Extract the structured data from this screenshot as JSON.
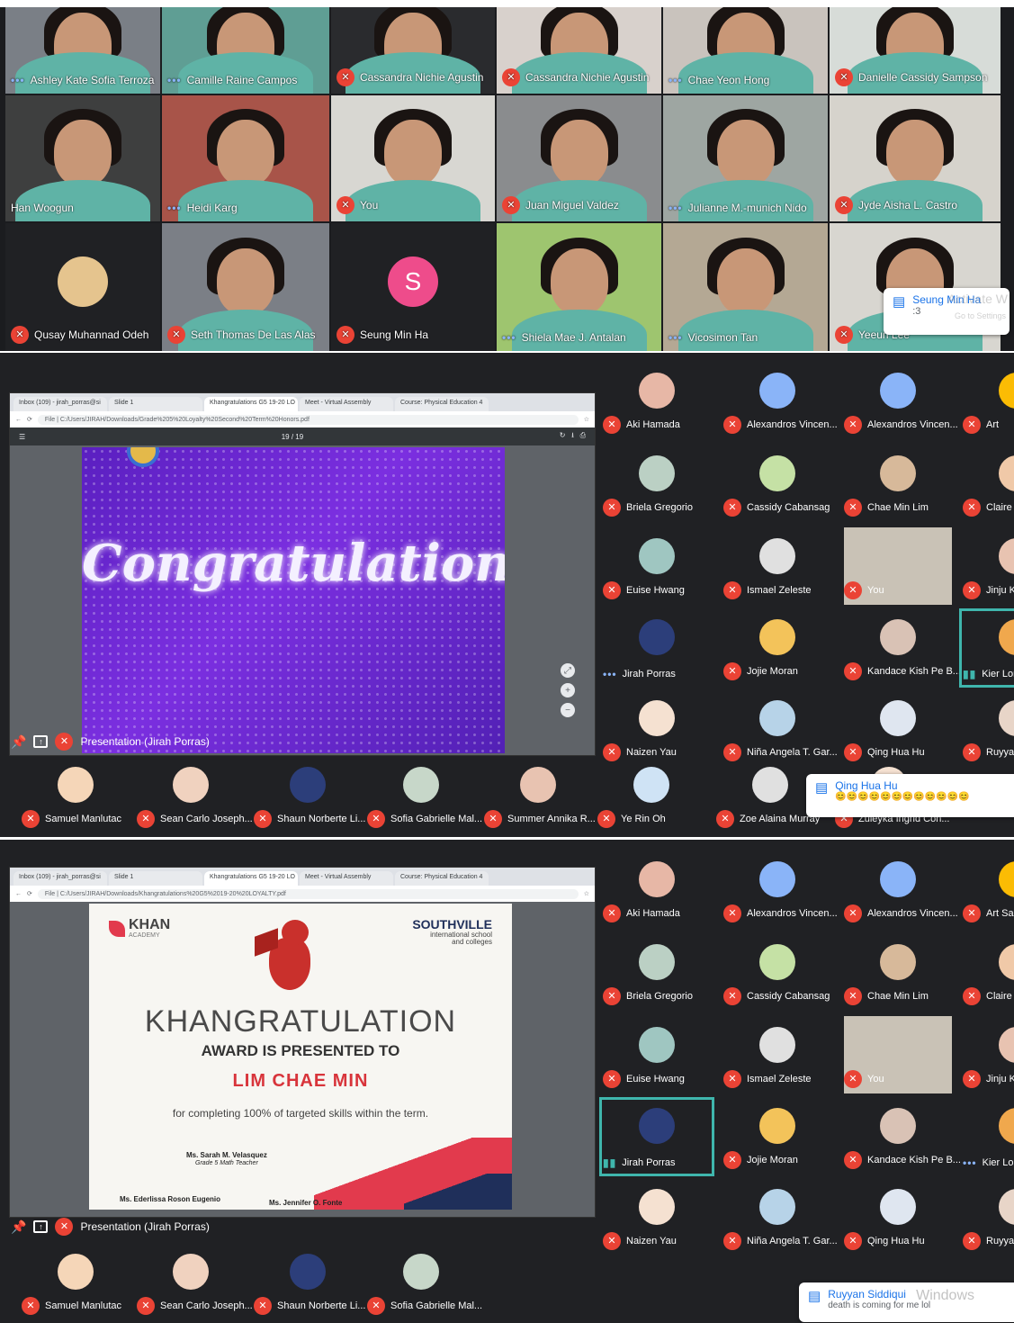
{
  "screen1": {
    "tiles": [
      {
        "name": "Ashley Kate Sofia Terroza",
        "status": "dots"
      },
      {
        "name": "Camille Raine Campos",
        "status": "dots"
      },
      {
        "name": "Cassandra Nichie Agustin",
        "status": "muted"
      },
      {
        "name": "Cassandra Nichie Agustin",
        "status": "muted"
      },
      {
        "name": "Chae Yeon Hong",
        "status": "dots"
      },
      {
        "name": "Danielle Cassidy Sampson",
        "status": "muted"
      },
      {
        "name": "Han Woogun",
        "status": "none"
      },
      {
        "name": "Heidi Karg",
        "status": "dots"
      },
      {
        "name": "You",
        "status": "muted"
      },
      {
        "name": "Juan Miguel Valdez",
        "status": "muted"
      },
      {
        "name": "Julianne M.-munich Nido",
        "status": "dots"
      },
      {
        "name": "Jyde Aisha L. Castro",
        "status": "muted"
      },
      {
        "name": "Qusay Muhannad Odeh",
        "status": "muted"
      },
      {
        "name": "Seth Thomas De Las Alas",
        "status": "muted"
      },
      {
        "name": "Seung Min Ha",
        "status": "muted"
      },
      {
        "name": "Shiela Mae J. Antalan",
        "status": "dots"
      },
      {
        "name": "Vicosimon Tan",
        "status": "dots"
      },
      {
        "name": "Yeeun Lee",
        "status": "muted"
      }
    ],
    "avatar_letter": "S",
    "chat": {
      "sender": "Seung Min Ha",
      "message": ":3"
    },
    "watermark": "Activate W",
    "watermark_sub": "Go to Settings"
  },
  "screen2": {
    "browser_tabs": [
      "Inbox (109) - jirah_porras@si",
      "Slide 1",
      "Khangratulations G5 19-20 LO",
      "Meet - Virtual Assembly",
      "Course: Physical Education 4"
    ],
    "url": "File | C:/Users/JIRAH/Downloads/Grade%205%20Loyalty%20Second%20Term%20Honors.pdf",
    "page_count": "19 / 19",
    "slide_text": "Congratulations!",
    "presentation_label": "Presentation (Jirah Porras)",
    "participants": [
      {
        "name": "Aki Hamada",
        "status": "muted"
      },
      {
        "name": "Alexandros Vincen...",
        "status": "muted"
      },
      {
        "name": "Alexandros Vincen...",
        "status": "muted"
      },
      {
        "name": "Art",
        "status": "muted"
      },
      {
        "name": "Briela Gregorio",
        "status": "muted"
      },
      {
        "name": "Cassidy Cabansag",
        "status": "muted"
      },
      {
        "name": "Chae Min Lim",
        "status": "muted"
      },
      {
        "name": "Claire",
        "status": "muted"
      },
      {
        "name": "Euise Hwang",
        "status": "muted"
      },
      {
        "name": "Ismael Zeleste",
        "status": "muted"
      },
      {
        "name": "You",
        "status": "muted"
      },
      {
        "name": "Jinju K",
        "status": "muted"
      },
      {
        "name": "Jirah Porras",
        "status": "dots"
      },
      {
        "name": "Jojie Moran",
        "status": "muted"
      },
      {
        "name": "Kandace Kish Pe B...",
        "status": "muted"
      },
      {
        "name": "Kier Lor",
        "status": "speaking"
      },
      {
        "name": "Naizen Yau",
        "status": "muted"
      },
      {
        "name": "Niña Angela T. Gar...",
        "status": "muted"
      },
      {
        "name": "Qing Hua Hu",
        "status": "muted"
      },
      {
        "name": "Ruyyan S",
        "status": "muted"
      }
    ],
    "strip": [
      {
        "name": "Samuel Manlutac"
      },
      {
        "name": "Sean Carlo Joseph..."
      },
      {
        "name": "Shaun Norberte Li..."
      },
      {
        "name": "Sofia Gabrielle Mal..."
      },
      {
        "name": "Summer Annika R..."
      },
      {
        "name": "Ye Rin Oh"
      },
      {
        "name": "Zoe Alaina Murray"
      },
      {
        "name": "Zuleyka Ingrid Con..."
      }
    ],
    "chat": {
      "sender": "Qing Hua Hu",
      "message": "😊😊😊😊😊😊😊😊😊😊😊😊"
    }
  },
  "screen3": {
    "browser_tabs": [
      "Inbox (109) - jirah_porras@si",
      "Slide 1",
      "Khangratulations G5 19-20 LO",
      "Meet - Virtual Assembly",
      "Course: Physical Education 4"
    ],
    "url": "File | C:/Users/JIRAH/Downloads/Khangratulations%20G5%2019-20%20LOYALTY.pdf",
    "cert": {
      "khan": "KHAN",
      "academy": "ACADEMY",
      "school": "SOUTHVILLE",
      "school_sub1": "international school",
      "school_sub2": "and colleges",
      "title": "KHANGRATULATION",
      "subtitle": "AWARD IS PRESENTED TO",
      "awardee": "LIM CHAE MIN",
      "body": "for completing 100% of targeted skills within the term.",
      "signer1": "Ms. Sarah M. Velasquez",
      "signer1_role": "Grade 5 Math Teacher",
      "signer2": "Ms. Ederlissa Roson Eugenio",
      "signer3": "Ms. Jennifer O. Fonte"
    },
    "presentation_label": "Presentation (Jirah Porras)",
    "participants": [
      {
        "name": "Aki Hamada",
        "status": "muted"
      },
      {
        "name": "Alexandros Vincen...",
        "status": "muted"
      },
      {
        "name": "Alexandros Vincen...",
        "status": "muted"
      },
      {
        "name": "Art Sa",
        "status": "muted"
      },
      {
        "name": "Briela Gregorio",
        "status": "muted"
      },
      {
        "name": "Cassidy Cabansag",
        "status": "muted"
      },
      {
        "name": "Chae Min Lim",
        "status": "muted"
      },
      {
        "name": "Claire C",
        "status": "muted"
      },
      {
        "name": "Euise Hwang",
        "status": "muted"
      },
      {
        "name": "Ismael Zeleste",
        "status": "muted"
      },
      {
        "name": "You",
        "status": "muted"
      },
      {
        "name": "Jinju Ki",
        "status": "muted"
      },
      {
        "name": "Jirah Porras",
        "status": "speaking"
      },
      {
        "name": "Jojie Moran",
        "status": "muted"
      },
      {
        "name": "Kandace Kish Pe B...",
        "status": "muted"
      },
      {
        "name": "Kier Lore",
        "status": "dots"
      },
      {
        "name": "Naizen Yau",
        "status": "muted"
      },
      {
        "name": "Niña Angela T. Gar...",
        "status": "muted"
      },
      {
        "name": "Qing Hua Hu",
        "status": "muted"
      },
      {
        "name": "Ruyyan S",
        "status": "muted"
      }
    ],
    "strip": [
      {
        "name": "Samuel Manlutac"
      },
      {
        "name": "Sean Carlo Joseph..."
      },
      {
        "name": "Shaun Norberte Li..."
      },
      {
        "name": "Sofia Gabrielle Mal..."
      }
    ],
    "chat": {
      "sender": "Ruyyan Siddiqui",
      "message": "death is coming for me lol"
    },
    "watermark": "Windows"
  },
  "colors": {
    "muted_red": "#ea4335",
    "accent_teal": "#3fb6ad",
    "meet_bg": "#202124",
    "chat_blue": "#1a73e8"
  }
}
